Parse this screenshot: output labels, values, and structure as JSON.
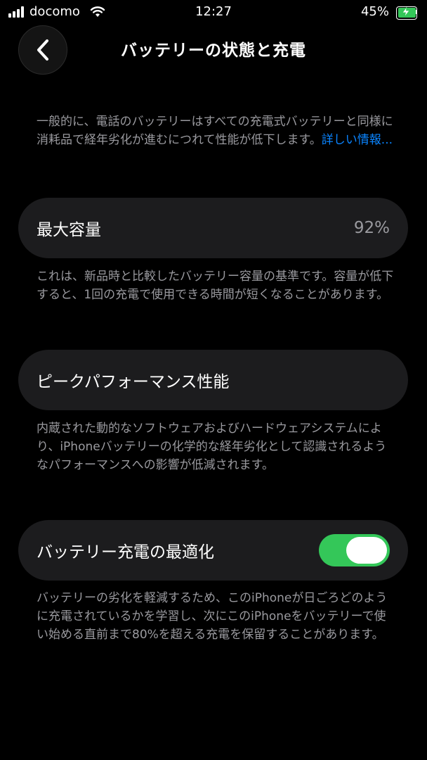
{
  "status_bar": {
    "carrier": "docomo",
    "time": "12:27",
    "battery_percent": "45%",
    "battery_color": "#34c759",
    "icons": [
      "signal-icon",
      "wifi-icon",
      "battery-charging-icon"
    ]
  },
  "nav": {
    "title": "バッテリーの状態と充電",
    "back_icon": "chevron-left-icon"
  },
  "intro": {
    "text": "一般的に、電話のバッテリーはすべての充電式バッテリーと同様に消耗品で経年劣化が進むにつれて性能が低下します。",
    "link": "詳しい情報..."
  },
  "max_capacity": {
    "label": "最大容量",
    "value": "92%",
    "description": "これは、新品時と比較したバッテリー容量の基準です。容量が低下すると、1回の充電で使用できる時間が短くなることがあります。"
  },
  "peak_performance": {
    "label": "ピークパフォーマンス性能",
    "description": "内蔵された動的なソフトウェアおよびハードウェアシステムにより、iPhoneバッテリーの化学的な経年劣化として認識されるようなパフォーマンスへの影響が低減されます。"
  },
  "optimized_charging": {
    "label": "バッテリー充電の最適化",
    "toggle_on": true,
    "toggle_color": "#34c759",
    "description": "バッテリーの劣化を軽減するため、このiPhoneが日ごろどのように充電されているかを学習し、次にこのiPhoneをバッテリーで使い始める直前まで80%を超える充電を保留することがあります。"
  }
}
